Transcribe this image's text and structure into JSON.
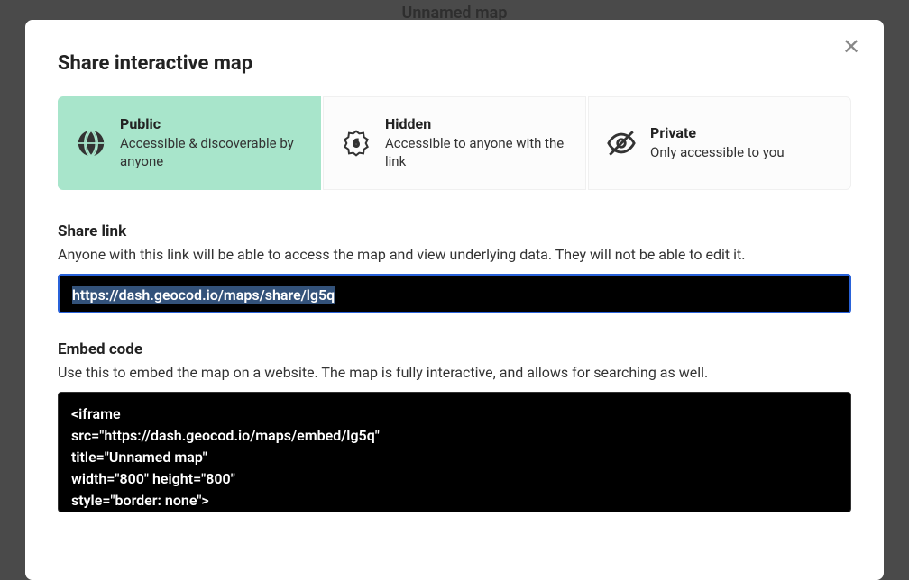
{
  "background": {
    "map_title": "Unnamed map"
  },
  "modal": {
    "title": "Share interactive map",
    "close_label": "✕",
    "visibility": {
      "options": {
        "public": {
          "title": "Public",
          "desc": "Accessible & discoverable by anyone"
        },
        "hidden": {
          "title": "Hidden",
          "desc": "Accessible to anyone with the link"
        },
        "private": {
          "title": "Private",
          "desc": "Only accessible to you"
        }
      },
      "selected": "public"
    },
    "share_link": {
      "label": "Share link",
      "help": "Anyone with this link will be able to access the map and view underlying data. They will not be able to edit it.",
      "url": "https://dash.geocod.io/maps/share/lg5q"
    },
    "embed": {
      "label": "Embed code",
      "help": "Use this to embed the map on a website. The map is fully interactive, and allows for searching as well.",
      "code": "<iframe\nsrc=\"https://dash.geocod.io/maps/embed/lg5q\"\ntitle=\"Unnamed map\"\nwidth=\"800\" height=\"800\"\nstyle=\"border: none\">"
    }
  }
}
